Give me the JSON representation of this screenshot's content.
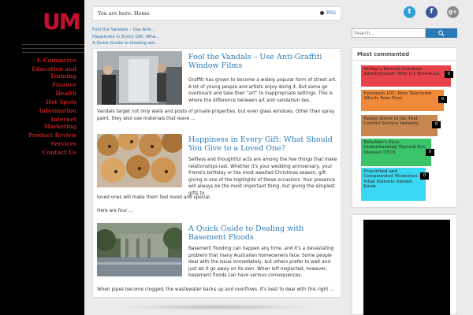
{
  "sidebar": {
    "logo_text": "UM",
    "nav": [
      "E-Commerce",
      "Education and",
      "Training",
      "Finance",
      "Health",
      "Hot Spots",
      "Information",
      "Internet",
      "Marketing",
      "Product Review",
      "Services",
      "Contact Us"
    ]
  },
  "breadcrumb": {
    "text": "You are here: Home",
    "rss": "RSS"
  },
  "recent_links": [
    "Fool the Vandals – Use Anti...",
    "Happiness in Every Gift: Wha...",
    "A Quick Guide to Dealing wit..."
  ],
  "posts": [
    {
      "title": "Fool the Vandals – Use Anti-Graffiti Window Films",
      "side_text": "Graffiti has grown to become a widely popular form of street art. A lot of young people and artists enjoy doing it. But some go overboard and take their \"art\" to inappropriate settings. This is where the difference between art and vandalism lies.",
      "full_text": "Vandals target not only walls and posts of private properties, but even glass windows. Other than spray paint, they also use materials that leave ..."
    },
    {
      "title": "Happiness in Every Gift: What Should You Give to a Loved One?",
      "side_text": "Selfless and thoughtful acts are among the few things that make relationships last. Whether it's your wedding anniversary, your friend's birthday or the most awaited Christmas season, gift giving is one of the highlights of these occasions. Your presence will always be the most important thing, but giving the simplest gifts to",
      "full_text": "loved ones will make them feel loved and special.",
      "extra_text": "Here are four ..."
    },
    {
      "title": "A Quick Guide to Dealing with Basement Floods",
      "side_text": "Basement flooding can happen any time, and it's a devastating problem that many Australian homeowners face. Some people deal with the issue immediately, but others prefer to wait and just let it go away on its own. When left neglected, however, basement floods can have serious consequences.",
      "full_text": "When pipes become clogged, the wastewater backs up and overflows.  It's best to deal with this right ..."
    }
  ],
  "search": {
    "placeholder": "Search..."
  },
  "most_commented": {
    "title": "Most commented",
    "items": [
      {
        "label": "Hiring a Remote Database Administrator: Why It's Beneficial",
        "count": "0",
        "color": "#e8434b"
      },
      {
        "label": "Eyestrain 101: How Television Affects Your Eyes",
        "count": "0",
        "color": "#f08a3a"
      },
      {
        "label": "Rising Above in the Pest Control Service Industry",
        "count": "0",
        "color": "#c8874f"
      },
      {
        "label": "Beholder's Eyes: Understanding Thyroid Eye Disease (TED)",
        "count": "0",
        "color": "#3cc46a"
      },
      {
        "label": "Prescribed and Compounded Medicines: What Patients Should Know",
        "count": "0",
        "color": "#3ad8f2"
      }
    ]
  },
  "colors": {
    "nav_red": "#b91c1c",
    "link_blue": "#2a7ab8",
    "sidebar_bg": "#000000"
  }
}
